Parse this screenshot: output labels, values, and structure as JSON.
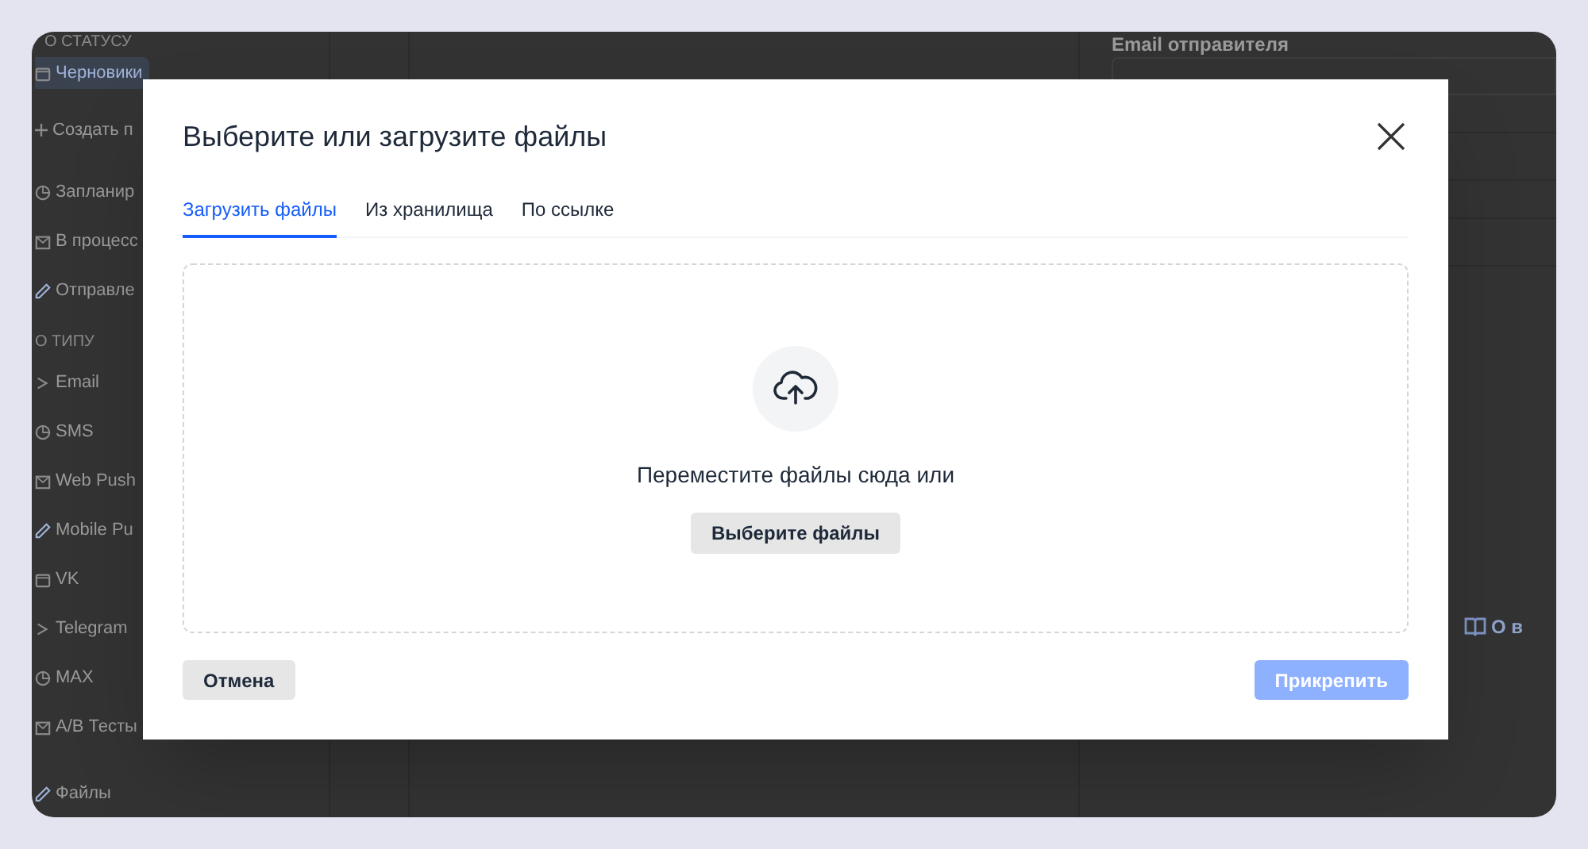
{
  "sidebar": {
    "items": [
      {
        "kind": "section",
        "label": "О СТАТУСУ"
      },
      {
        "kind": "item",
        "label": "Черновики",
        "selected": true
      },
      {
        "kind": "action",
        "label": "Создать п"
      },
      {
        "kind": "item",
        "label": "Запланир",
        "selected": false
      },
      {
        "kind": "item",
        "label": "В процесс",
        "selected": false
      },
      {
        "kind": "item",
        "label": "Отправле",
        "selected": false
      },
      {
        "kind": "section",
        "label": "О ТИПУ"
      },
      {
        "kind": "item",
        "label": "Email",
        "selected": false
      },
      {
        "kind": "item",
        "label": "SMS",
        "selected": false
      },
      {
        "kind": "item",
        "label": "Web Push",
        "selected": false
      },
      {
        "kind": "item",
        "label": "Mobile Pu",
        "selected": false
      },
      {
        "kind": "item",
        "label": "VK",
        "selected": false
      },
      {
        "kind": "item",
        "label": "Telegram",
        "selected": false
      },
      {
        "kind": "item",
        "label": "MAX",
        "selected": false
      },
      {
        "kind": "item",
        "label": "A/B Тесты",
        "selected": false
      },
      {
        "kind": "item",
        "label": "Файлы",
        "selected": false
      }
    ]
  },
  "right_panel": {
    "field_label": "Email отправителя",
    "help_link": "О в"
  },
  "dialog": {
    "title": "Выберите или загрузите файлы",
    "tabs": [
      {
        "label": "Загрузить файлы",
        "selected": true
      },
      {
        "label": "Из хранилища",
        "selected": false
      },
      {
        "label": "По ссылке",
        "selected": false
      }
    ],
    "dropzone": {
      "text": "Переместите файлы сюда или",
      "button": "Выберите файлы"
    },
    "cancel": "Отмена",
    "attach": {
      "label": "Прикрепить",
      "disabled": true
    }
  }
}
